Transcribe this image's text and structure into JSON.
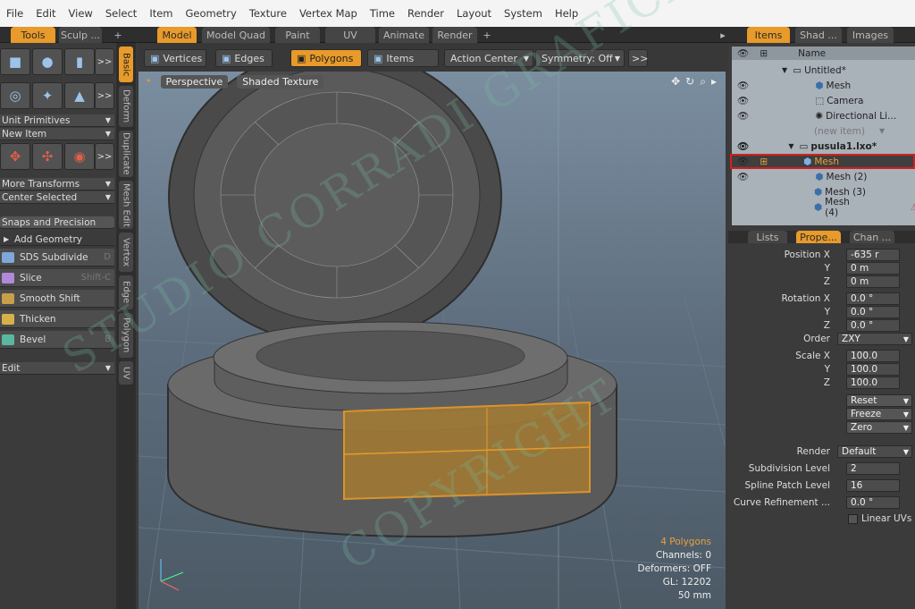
{
  "menu": [
    "File",
    "Edit",
    "View",
    "Select",
    "Item",
    "Geometry",
    "Texture",
    "Vertex Map",
    "Time",
    "Render",
    "Layout",
    "System",
    "Help"
  ],
  "left_tabs": [
    "Tools",
    "Sculp ...",
    "+"
  ],
  "main_tabs": [
    "Model",
    "Model Quad",
    "Paint",
    "UV",
    "Animate",
    "Render",
    "+"
  ],
  "right_tabs": [
    "Items",
    "Shad ...",
    "Images"
  ],
  "left_panel": {
    "dd1": "Unit Primitives",
    "dd2": "New Item",
    "dd3": "More Transforms",
    "dd4": "Center Selected",
    "snaps": "Snaps and Precision",
    "add_geo": "Add Geometry",
    "more": ">>",
    "edit": "Edit",
    "tools": [
      {
        "label": "SDS Subdivide",
        "shortcut": "D"
      },
      {
        "label": "Slice",
        "shortcut": "Shift-C"
      },
      {
        "label": "Smooth Shift",
        "shortcut": ""
      },
      {
        "label": "Thicken",
        "shortcut": ""
      },
      {
        "label": "Bevel",
        "shortcut": "B"
      }
    ]
  },
  "vertical_tabs": [
    "Basic",
    "Deform",
    "Duplicate",
    "Mesh Edit",
    "Vertex",
    "Edge",
    "Polygon",
    "UV"
  ],
  "viewport_toolbar": {
    "vertices": "Vertices",
    "edges": "Edges",
    "polygons": "Polygons",
    "items": "Items",
    "action": "Action Center",
    "symmetry": "Symmetry: Off",
    "more": ">>"
  },
  "viewport": {
    "view": "Perspective",
    "shading": "Shaded Texture",
    "info": {
      "polys": "4 Polygons",
      "channels": "Channels: 0",
      "deformers": "Deformers: OFF",
      "gl": "GL: 12202",
      "size": "50 mm"
    }
  },
  "items": {
    "header": "Name",
    "scene1": "Untitled*",
    "mesh": "Mesh",
    "camera": "Camera",
    "light": "Directional Li...",
    "new_item": "(new item)",
    "scene2": "pusula1.lxo*",
    "mesh_sel": "Mesh",
    "mesh2": "Mesh (2)",
    "mesh3": "Mesh (3)",
    "mesh4": "Mesh (4)"
  },
  "props_tabs": [
    "Lists",
    "Prope...",
    "Chan ..."
  ],
  "props": {
    "pos_label": "Position X",
    "pos_x": "-635 r",
    "pos_y": "0 m",
    "pos_z": "0 m",
    "rot_label": "Rotation X",
    "rot_x": "0.0 °",
    "rot_y": "0.0 °",
    "rot_z": "0.0 °",
    "order_label": "Order",
    "order": "ZXY",
    "scale_label": "Scale X",
    "scale_x": "100.0",
    "scale_y": "100.0",
    "scale_z": "100.0",
    "y": "Y",
    "z": "Z",
    "reset": "Reset",
    "freeze": "Freeze",
    "zero": "Zero",
    "render_label": "Render",
    "render": "Default",
    "subdiv_label": "Subdivision Level",
    "subdiv": "2",
    "spline_label": "Spline Patch Level",
    "spline": "16",
    "curve_label": "Curve Refinement ...",
    "curve": "0.0 °",
    "linear": "Linear UVs"
  },
  "watermark": {
    "line1": "STUDIO CORRADI GRAFICA",
    "line2": "COPYRIGHT"
  }
}
